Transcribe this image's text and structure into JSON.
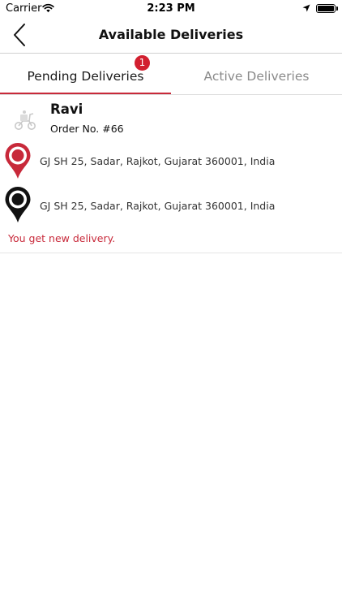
{
  "status_bar": {
    "carrier": "Carrier",
    "time": "2:23 PM"
  },
  "nav": {
    "title": "Available Deliveries"
  },
  "tabs": [
    {
      "label": "Pending Deliveries",
      "selected": true,
      "badge": "1"
    },
    {
      "label": "Active Deliveries",
      "selected": false
    }
  ],
  "delivery": {
    "name": "Ravi",
    "order": "Order No. #66",
    "pickup_address": "GJ SH 25, Sadar, Rajkot, Gujarat 360001, India",
    "drop_address": "GJ SH 25, Sadar, Rajkot, Gujarat 360001, India",
    "status": "You get new delivery."
  },
  "colors": {
    "accent": "#c8293a",
    "badge": "#d21f2f",
    "pickup_pin": "#c8293a",
    "drop_pin": "#111111"
  },
  "icons": {
    "back": "chevron-left-icon",
    "scooter": "scooter-icon",
    "pickup": "map-pin-icon",
    "drop": "map-pin-icon"
  }
}
